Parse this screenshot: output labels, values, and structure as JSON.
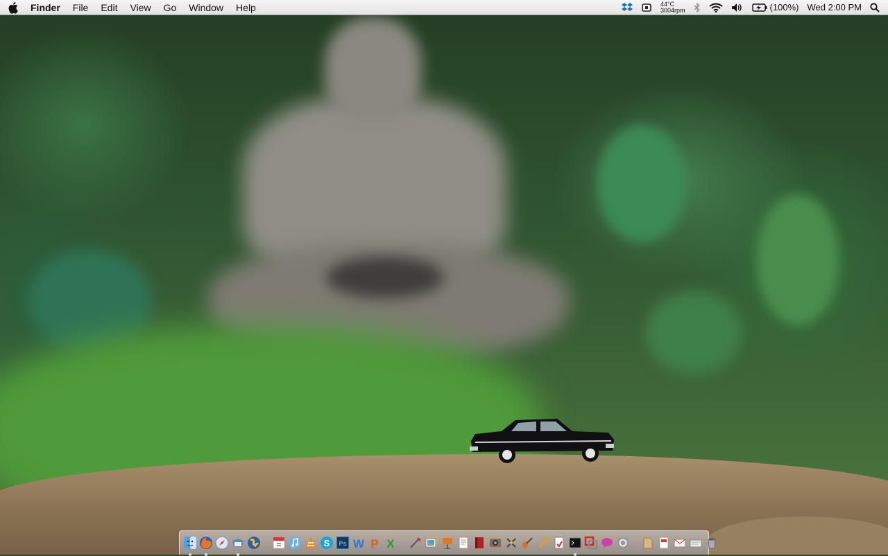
{
  "menubar": {
    "apple_icon": "apple-logo-icon",
    "app_name": "Finder",
    "menus": [
      "File",
      "Edit",
      "View",
      "Go",
      "Window",
      "Help"
    ],
    "status": {
      "temperature": "44°C",
      "fan_speed": "3004rpm",
      "battery": "(100%)",
      "clock": "Wed 2:00 PM"
    }
  },
  "dock": {
    "apps": [
      "finder-icon",
      "firefox-icon",
      "safari-icon",
      "mail-icon",
      "globe-icon",
      "calendar-icon",
      "itunes-icon",
      "vlc-icon",
      "skype-icon",
      "photoshop-icon",
      "word-icon",
      "powerpoint-icon",
      "excel-icon",
      "brush-icon",
      "preview-icon",
      "keynote-icon",
      "textedit-icon",
      "notebook-icon",
      "photo-booth-icon",
      "tools-icon",
      "guitar-icon",
      "wrench-icon",
      "script-icon",
      "terminal-icon",
      "parallels-icon",
      "chat-icon",
      "settings-icon"
    ],
    "stacks": [
      "documents-stack-icon",
      "pdf-stack-icon",
      "mail-stack-icon",
      "downloads-stack-icon",
      "trash-icon"
    ]
  },
  "colors": {
    "menubar": "#e8e8e8",
    "dock": "#c8c8d2"
  }
}
